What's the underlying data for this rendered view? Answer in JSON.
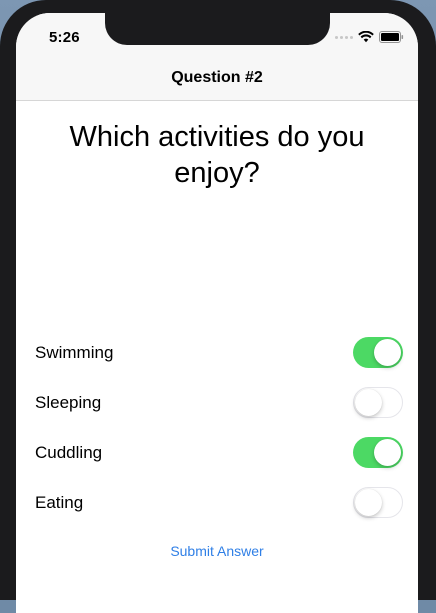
{
  "status_bar": {
    "time": "5:26"
  },
  "nav": {
    "title": "Question #2"
  },
  "question": {
    "text": "Which activities do you enjoy?"
  },
  "options": [
    {
      "label": "Swimming",
      "on": true
    },
    {
      "label": "Sleeping",
      "on": false
    },
    {
      "label": "Cuddling",
      "on": true
    },
    {
      "label": "Eating",
      "on": false
    }
  ],
  "submit": {
    "label": "Submit Answer"
  },
  "colors": {
    "switch_on": "#4cd964",
    "link": "#2f7fe6",
    "nav_background": "#f7f7f7"
  },
  "icons": [
    "signal-dots-icon",
    "wifi-icon",
    "battery-icon"
  ]
}
